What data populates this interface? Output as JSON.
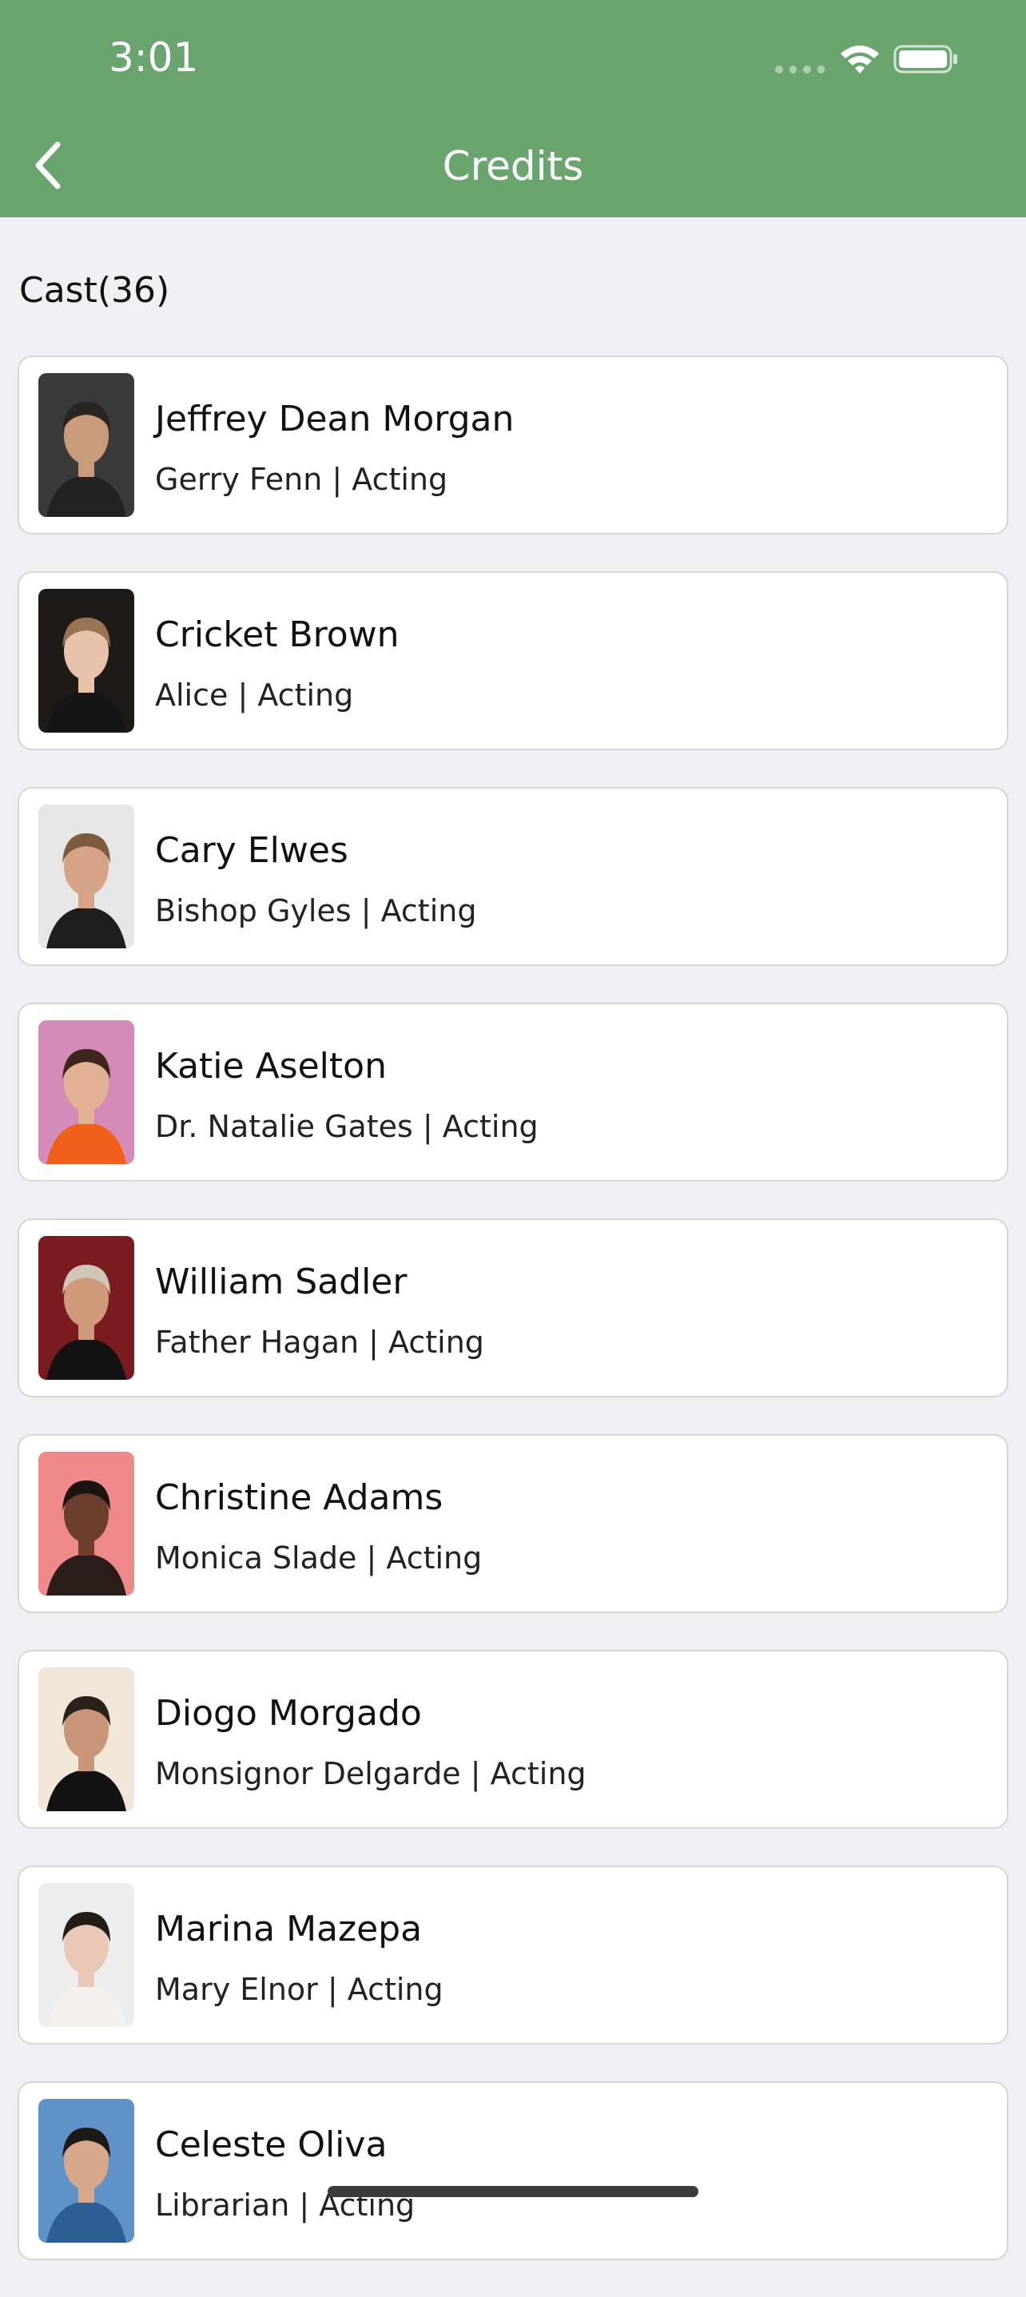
{
  "status": {
    "time": "3:01"
  },
  "nav": {
    "title": "Credits",
    "back_icon": "chevron-left-icon"
  },
  "cast_header": "Cast(36)",
  "cast": [
    {
      "name": "Jeffrey Dean Morgan",
      "role": "Gerry Fenn | Acting",
      "photo_bg": "#3a3a3a",
      "skin": "#c89b7b",
      "hair": "#2a2521",
      "shirt": "#222222"
    },
    {
      "name": "Cricket Brown",
      "role": "Alice | Acting",
      "photo_bg": "#1d1a18",
      "skin": "#e8c3ac",
      "hair": "#9a7353",
      "shirt": "#151515"
    },
    {
      "name": "Cary Elwes",
      "role": "Bishop Gyles | Acting",
      "photo_bg": "#e6e6e6",
      "skin": "#d6a387",
      "hair": "#7c5b3f",
      "shirt": "#1e1e1e"
    },
    {
      "name": "Katie Aselton",
      "role": "Dr. Natalie Gates | Acting",
      "photo_bg": "#d48bb7",
      "skin": "#e2b194",
      "hair": "#3d261b",
      "shirt": "#f0601b"
    },
    {
      "name": "William Sadler",
      "role": "Father Hagan | Acting",
      "photo_bg": "#7a1c1f",
      "skin": "#cf9a7a",
      "hair": "#cfc6b8",
      "shirt": "#121212"
    },
    {
      "name": "Christine Adams",
      "role": "Monica Slade | Acting",
      "photo_bg": "#f08a8a",
      "skin": "#6b3e2d",
      "hair": "#1b1411",
      "shirt": "#2a1d1a"
    },
    {
      "name": "Diogo Morgado",
      "role": "Monsignor Delgarde | Acting",
      "photo_bg": "#f1e6d8",
      "skin": "#c99579",
      "hair": "#2b211b",
      "shirt": "#121212"
    },
    {
      "name": "Marina Mazepa",
      "role": "Mary Elnor | Acting",
      "photo_bg": "#ededed",
      "skin": "#e8c9b6",
      "hair": "#231b18",
      "shirt": "#f4f1ec"
    },
    {
      "name": "Celeste Oliva",
      "role": "Librarian | Acting",
      "photo_bg": "#5f93c8",
      "skin": "#d6a78a",
      "hair": "#1d1917",
      "shirt": "#2d5e93"
    }
  ]
}
